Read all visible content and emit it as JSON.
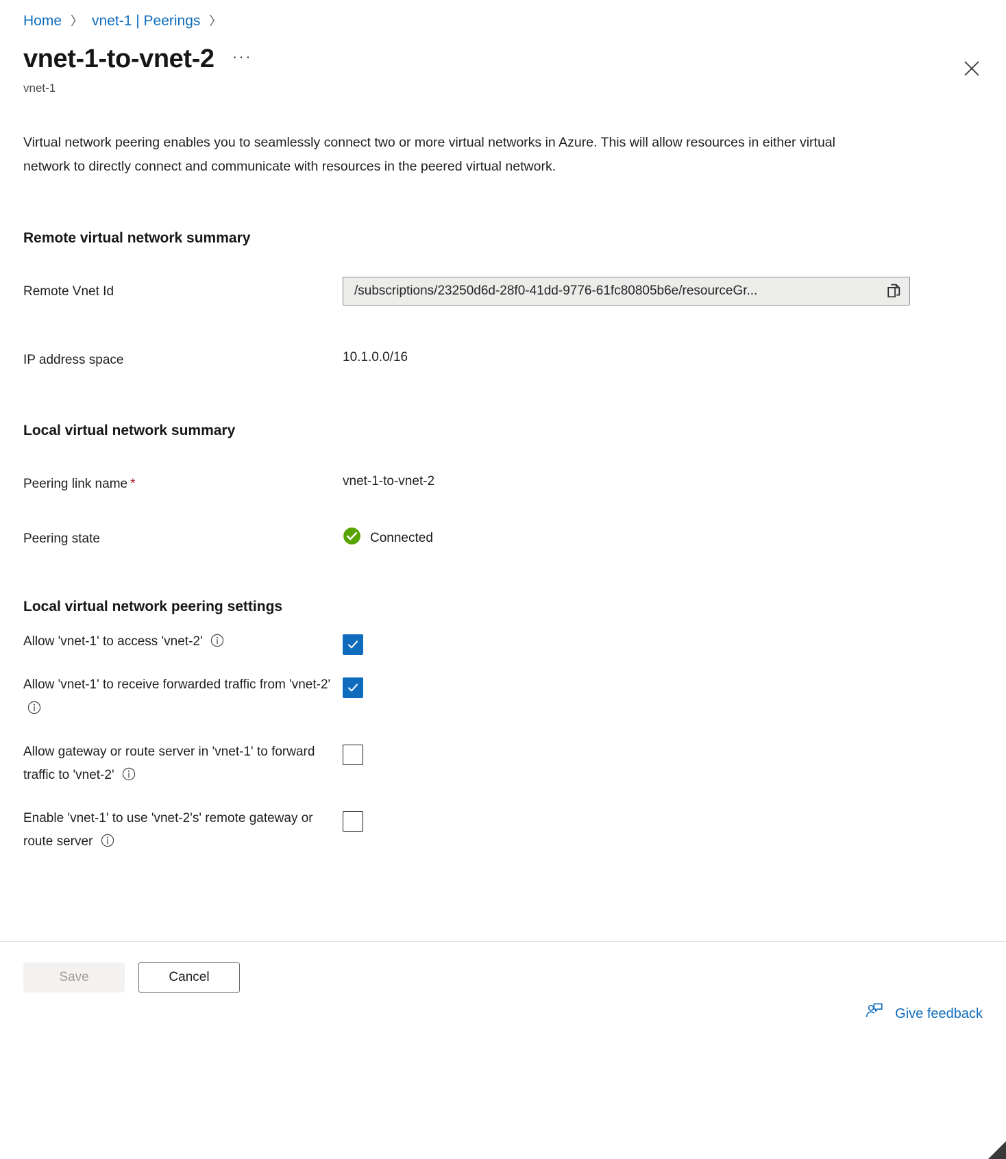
{
  "breadcrumb": {
    "items": [
      {
        "label": "Home",
        "icon": "chevron-right-icon"
      },
      {
        "label": "vnet-1 | Peerings",
        "icon": "chevron-right-icon"
      }
    ],
    "separator": "〉"
  },
  "header": {
    "title": "vnet-1-to-vnet-2",
    "subtitle": "vnet-1",
    "more_label": "···",
    "more_icon": "ellipsis-icon",
    "close_icon": "close-icon"
  },
  "description": "Virtual network peering enables you to seamlessly connect two or more virtual networks in Azure. This will allow resources in either virtual network to directly connect and communicate with resources in the peered virtual network.",
  "remote_summary": {
    "heading": "Remote virtual network summary",
    "vnet_id": {
      "label": "Remote Vnet Id",
      "value": "/subscriptions/23250d6d-28f0-41dd-9776-61fc80805b6e/resourceGr...",
      "copy_icon": "copy-icon"
    },
    "ip_space": {
      "label": "IP address space",
      "value": "10.1.0.0/16"
    }
  },
  "local_summary": {
    "heading": "Local virtual network summary",
    "link_name": {
      "label": "Peering link name",
      "required_mark": "*",
      "value": "vnet-1-to-vnet-2"
    },
    "peering_state": {
      "label": "Peering state",
      "value": "Connected",
      "status_icon": "check-circle-icon",
      "status_color": "#57a300"
    }
  },
  "peering_settings": {
    "heading": "Local virtual network peering settings",
    "options": [
      {
        "label": "Allow 'vnet-1' to access 'vnet-2'",
        "info_icon": "info-icon",
        "checked": true
      },
      {
        "label": "Allow 'vnet-1' to receive forwarded traffic from 'vnet-2'",
        "info_icon": "info-icon",
        "checked": true
      },
      {
        "label": "Allow gateway or route server in 'vnet-1' to forward traffic to 'vnet-2'",
        "info_icon": "info-icon",
        "checked": false
      },
      {
        "label": "Enable 'vnet-1' to use 'vnet-2's' remote gateway or route server",
        "info_icon": "info-icon",
        "checked": false
      }
    ]
  },
  "footer": {
    "save_label": "Save",
    "cancel_label": "Cancel",
    "feedback_label": "Give feedback",
    "feedback_icon": "feedback-person-icon"
  },
  "colors": {
    "accent": "#0f6cbd",
    "link": "#0f6cbd",
    "success": "#57a300",
    "required": "#a4262c"
  }
}
